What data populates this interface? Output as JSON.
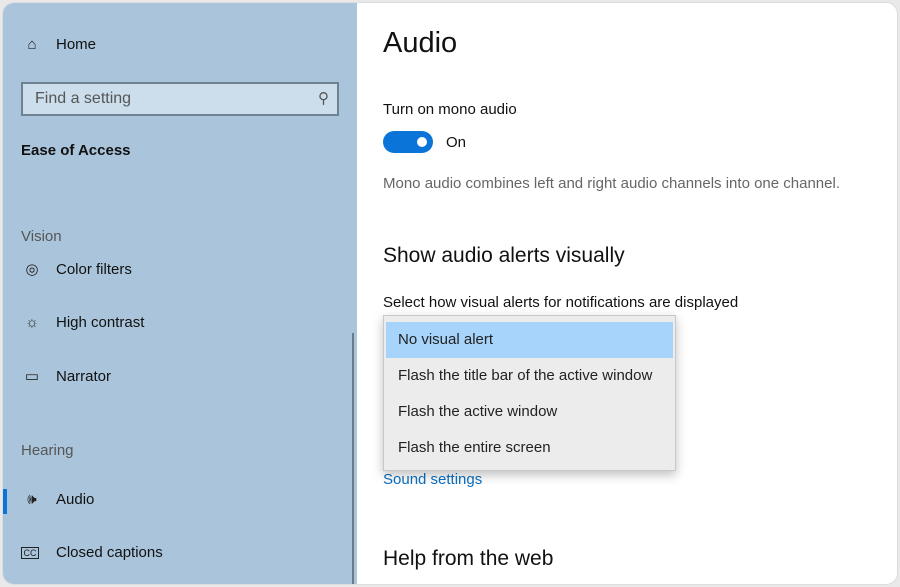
{
  "sidebar": {
    "home": "Home",
    "search_placeholder": "Find a setting",
    "category": "Ease of Access",
    "vision_header": "Vision",
    "vision_items": [
      "Color filters",
      "High contrast",
      "Narrator"
    ],
    "hearing_header": "Hearing",
    "hearing_items": [
      "Audio",
      "Closed captions"
    ],
    "selected": "Audio"
  },
  "main": {
    "title": "Audio",
    "mono_label": "Turn on mono audio",
    "mono_state": "On",
    "mono_desc": "Mono audio combines left and right audio channels into one channel.",
    "alerts_heading": "Show audio alerts visually",
    "alerts_label": "Select how visual alerts for notifications are displayed",
    "alert_options": [
      "No visual alert",
      "Flash the title bar of the active window",
      "Flash the active window",
      "Flash the entire screen"
    ],
    "selected_option": "No visual alert",
    "sound_settings_link": "Sound settings",
    "help_heading": "Help from the web"
  },
  "colors": {
    "accent": "#0a74d8",
    "sidebar": "#aac5db",
    "highlight": "#a6d4fb"
  }
}
